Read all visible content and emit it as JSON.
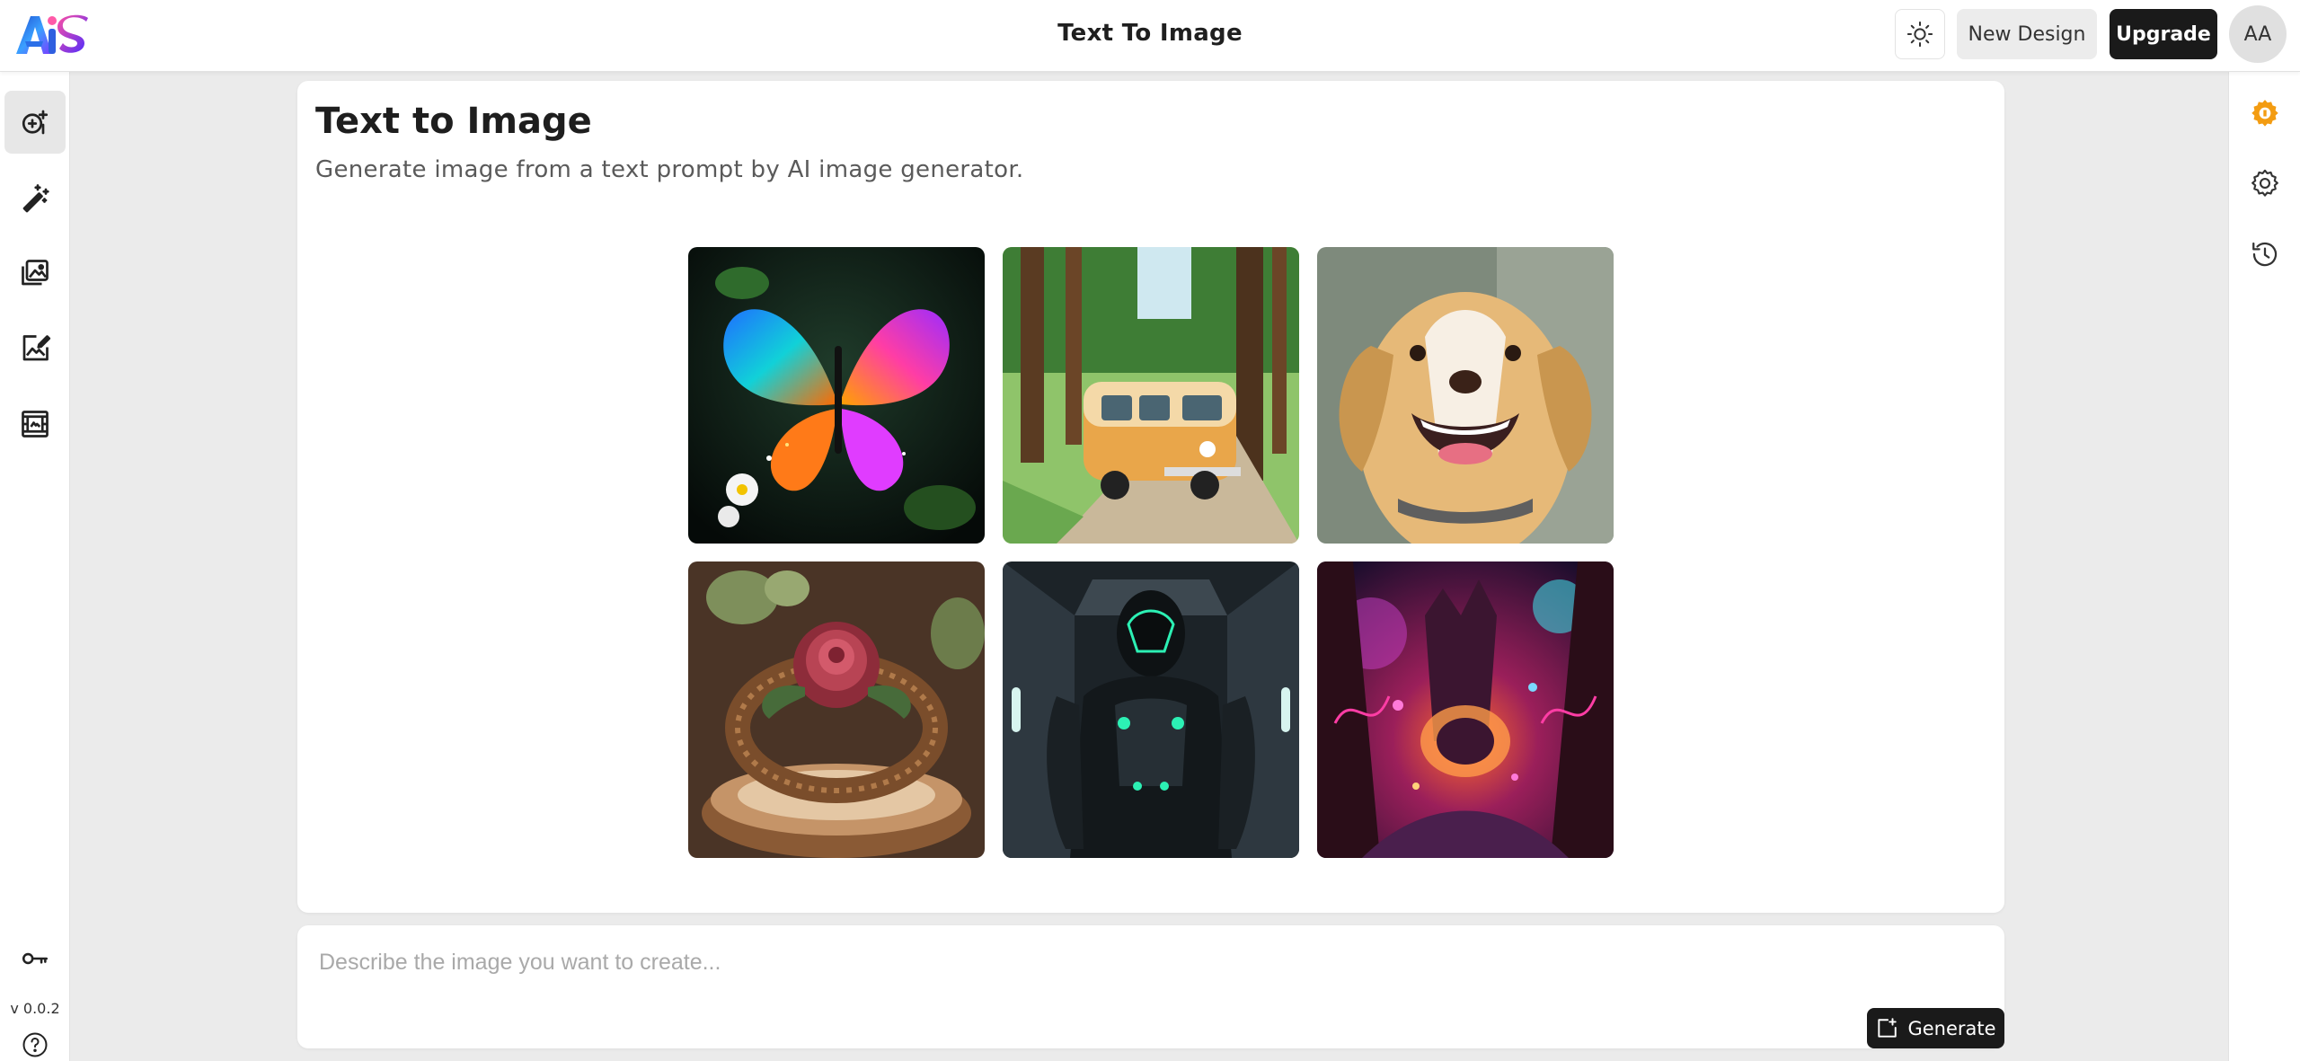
{
  "header": {
    "logo_text": "AiS",
    "title": "Text To Image",
    "theme_icon": "sun-icon",
    "new_design_label": "New Design",
    "upgrade_label": "Upgrade",
    "avatar_initials": "AA"
  },
  "left_sidebar": {
    "items": [
      {
        "icon": "text-to-image-icon",
        "active": true
      },
      {
        "icon": "magic-wand-icon",
        "active": false
      },
      {
        "icon": "image-gallery-icon",
        "active": false
      },
      {
        "icon": "image-edit-icon",
        "active": false
      },
      {
        "icon": "frame-icon",
        "active": false
      }
    ],
    "key_icon": "key-icon",
    "version": "v 0.0.2",
    "help_icon": "help-icon"
  },
  "right_sidebar": {
    "items": [
      {
        "icon": "credits-gear-icon"
      },
      {
        "icon": "settings-icon"
      },
      {
        "icon": "history-icon"
      }
    ]
  },
  "main": {
    "title": "Text to Image",
    "subtitle": "Generate image from a text prompt by AI image generator.",
    "gallery": [
      {
        "icon": "butterfly-image"
      },
      {
        "icon": "vw-van-image"
      },
      {
        "icon": "dog-image"
      },
      {
        "icon": "rose-ring-image"
      },
      {
        "icon": "robot-image"
      },
      {
        "icon": "fantasy-forest-image"
      }
    ]
  },
  "prompt": {
    "placeholder": "Describe the image you want to create...",
    "value": "",
    "generate_label": "Generate",
    "generate_icon": "generate-icon"
  },
  "colors": {
    "accent": "#1a1a1a",
    "credits": "#f39c12",
    "background": "#ebebeb"
  }
}
